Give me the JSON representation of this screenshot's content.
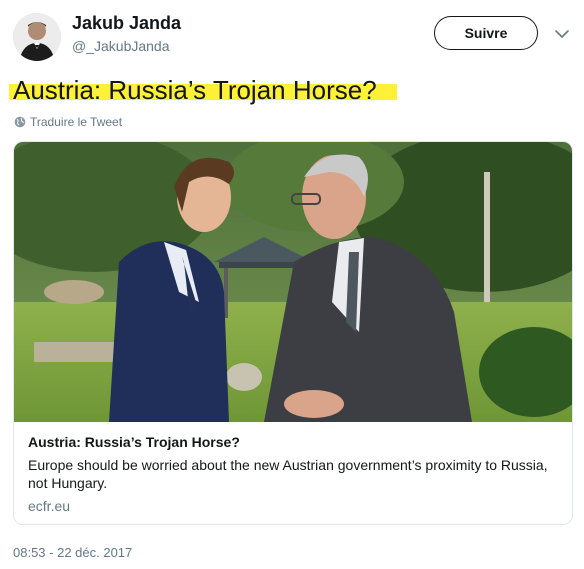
{
  "author": {
    "name": "Jakub Janda",
    "handle": "@_JakubJanda"
  },
  "follow_button": {
    "label": "Suivre"
  },
  "tweet": {
    "text": "Austria: Russia’s Trojan Horse?",
    "translate_label": "Traduire le Tweet",
    "timestamp": "08:53 - 22 déc. 2017"
  },
  "card": {
    "title": "Austria: Russia’s Trojan Horse?",
    "description": "Europe should be worried about the new Austrian government’s proximity to Russia, not Hungary.",
    "domain": "ecfr.eu"
  },
  "colors": {
    "highlight": "#ffee22",
    "secondary_text": "#657786",
    "border": "#e1e8ed"
  },
  "icons": {
    "caret": "chevron-down-icon",
    "globe": "globe-icon"
  }
}
